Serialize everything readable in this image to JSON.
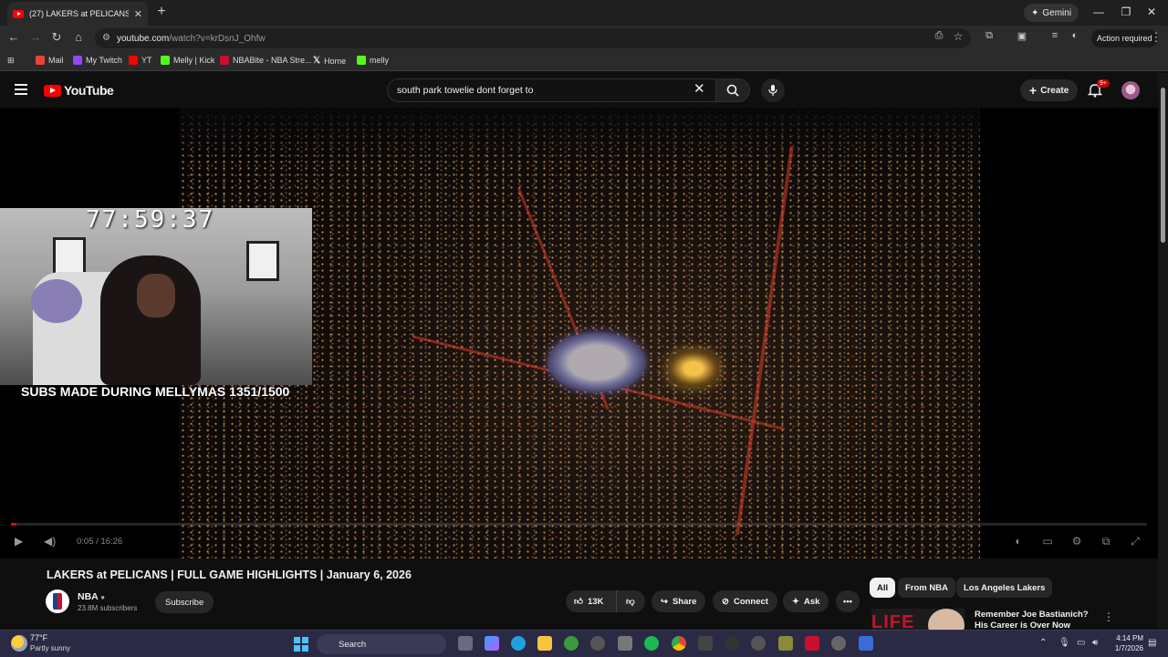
{
  "browser": {
    "tab": {
      "title": "(27) LAKERS at PELICANS | FULL GA",
      "close": "✕"
    },
    "new_tab": "+",
    "gemini_label": "Gemini",
    "window_controls": {
      "minimize": "—",
      "restore": "❐",
      "close": "✕"
    },
    "url": {
      "host": "youtube.com",
      "path": "/watch?v=krDsnJ_Ohfw"
    },
    "action_required": "Action required",
    "bookmarks": [
      {
        "label": "Mail",
        "icon": "gmail-icon",
        "color": "#ea4335"
      },
      {
        "label": "My Twitch",
        "icon": "twitch-icon",
        "color": "#9146ff"
      },
      {
        "label": "YT",
        "icon": "youtube-icon",
        "color": "#ff0000"
      },
      {
        "label": "Melly | Kick",
        "icon": "kick-icon",
        "color": "#53fc18"
      },
      {
        "label": "NBABite - NBA Stre...",
        "icon": "nbabite-icon",
        "color": "#c8102e"
      },
      {
        "label": "Home",
        "icon": "x-icon",
        "color": "#000000"
      },
      {
        "label": "melly",
        "icon": "kick-icon",
        "color": "#53fc18"
      }
    ]
  },
  "youtube": {
    "logo_text": "YouTube",
    "search_query": "south park towelie dont forget to",
    "create_label": "Create",
    "notification_badge": "9+",
    "overlay": {
      "timer": "77:59:37",
      "subs_text": "SUBS MADE DURING MELLYMAS 1351/1500"
    },
    "player": {
      "time": "0:05 / 16:26",
      "progress": 0.005
    },
    "video": {
      "title": "LAKERS at PELICANS | FULL GAME HIGHLIGHTS | January 6, 2026",
      "channel": "NBA",
      "subscribers": "23.8M subscribers",
      "subscribe_label": "Subscribe",
      "likes": "13K",
      "share_label": "Share",
      "connect_label": "Connect",
      "ask_label": "Ask",
      "more": "•••"
    },
    "chips": [
      "All",
      "From NBA",
      "Los Angeles Lakers"
    ],
    "recommendation": {
      "thumb_text": "LIFE",
      "title": "Remember Joe Bastianich? His Career is Over Now"
    }
  },
  "taskbar": {
    "temperature": "77°F",
    "weather": "Partly sunny",
    "search_label": "Search",
    "time": "4:14 PM",
    "date": "1/7/2026"
  },
  "colors": {
    "youtube_red": "#ff0000",
    "background": "#0f0f0f",
    "windows_accent": "#4cc2ff"
  }
}
